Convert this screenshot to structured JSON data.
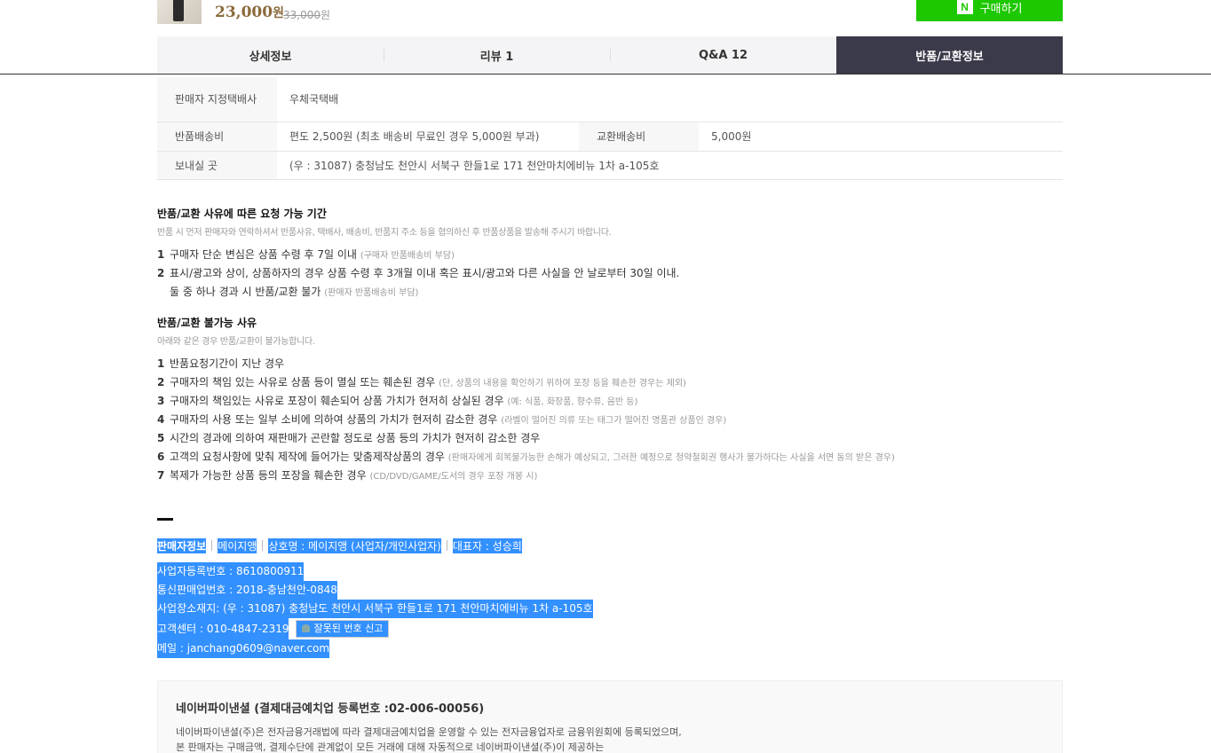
{
  "top": {
    "price": "23,000",
    "price_unit": "원",
    "original_price": "33,000",
    "original_unit": "원",
    "buy_icon": "N",
    "buy_label": "구매하기"
  },
  "tabs": [
    {
      "label": "상세정보"
    },
    {
      "label": "리뷰 1"
    },
    {
      "label": "Q&A 12"
    },
    {
      "label": "반품/교환정보",
      "active": true
    }
  ],
  "info_table": {
    "courier_label": "판매자 지정택배사",
    "courier_value": "우체국택배",
    "return_fee_label": "반품배송비",
    "return_fee_value": "편도 2,500원 (최초 배송비 무료인 경우 5,000원 부과)",
    "exchange_fee_label": "교환배송비",
    "exchange_fee_value": "5,000원",
    "address_label": "보내실 곳",
    "address_value": "(우 : 31087) 충청남도 천안시 서북구 한들1로 171 천안마치에비뉴 1차 a-105호"
  },
  "request_period": {
    "title": "반품/교환 사유에 따른 요청 가능 기간",
    "subtitle": "반품 시 먼저 판매자와 연락하셔서 반품사유, 택배사, 배송비, 반품지 주소 등을 협의하신 후 반품상품을 발송해 주시기 바랍니다.",
    "items": [
      {
        "num": "1",
        "text": "구매자 단순 변심은 상품 수령 후 7일 이내",
        "note": "(구매자 반품배송비 부담)"
      },
      {
        "num": "2",
        "text": "표시/광고와 상이, 상품하자의 경우 상품 수령 후 3개월 이내 혹은 표시/광고와 다른 사실을 안 날로부터 30일 이내.",
        "note": ""
      }
    ],
    "continuation_text": "둘 중 하나 경과 시 반품/교환 불가",
    "continuation_note": "(판매자 반품배송비 부담)"
  },
  "not_allowed": {
    "title": "반품/교환 불가능 사유",
    "subtitle": "아래와 같은 경우 반품/교환이 불가능합니다.",
    "items": [
      {
        "num": "1",
        "text": "반품요청기간이 지난 경우",
        "note": ""
      },
      {
        "num": "2",
        "text": "구매자의 책임 있는 사유로 상품 등이 멸실 또는 훼손된 경우",
        "note": "(단, 상품의 내용을 확인하기 위하여 포장 등을 훼손한 경우는 제외)"
      },
      {
        "num": "3",
        "text": "구매자의 책임있는 사유로 포장이 훼손되어 상품 가치가 현저히 상실된 경우",
        "note": "(예: 식품, 화장품, 향수류, 음반 등)"
      },
      {
        "num": "4",
        "text": "구매자의 사용 또는 일부 소비에 의하여 상품의 가치가 현저히 감소한 경우",
        "note": "(라벨이 떨어진 의류 또는 태그가 떨어진 명품관 상품인 경우)"
      },
      {
        "num": "5",
        "text": "시간의 경과에 의하여 재판매가 곤란할 정도로 상품 등의 가치가 현저히 감소한 경우",
        "note": ""
      },
      {
        "num": "6",
        "text": "고객의 요청사항에 맞춰 제작에 들어가는 맞춤제작상품의 경우",
        "note": "(판매자에게 회복불가능한 손해가 예상되고, 그러한 예정으로 청약철회권 행사가 불가하다는 사실을 서면 동의 받은 경우)"
      },
      {
        "num": "7",
        "text": "복제가 가능한 상품 등의 포장을 훼손한 경우",
        "note": "(CD/DVD/GAME/도서의 경우 포장 개봉 시)"
      }
    ]
  },
  "seller": {
    "label": "판매자정보",
    "shop": "메이지앵",
    "company": "상호명 : 메이지앵 (사업자/개인사업자)",
    "ceo": "대표자 : 성승희",
    "biz_no": "사업자등록번호 : 8610800911",
    "mail_order_no": "통신판매업번호 : 2018-충남천안-0848",
    "address": "사업장소재지: (우 : 31087) 충청남도 천안시 서북구 한들1로 171 천안마치에비뉴 1차 a-105호",
    "phone": "고객센터 : 010-4847-2319",
    "report_label": "잘못된 번호 신고",
    "email": "메일 : janchang0609@naver.com"
  },
  "naverpay": {
    "title": "네이버파이낸셜 (결제대금예치업 등록번호 :02-006-00056)",
    "line1": "네이버파이낸셜(주)은 전자금융거래법에 따라 결제대금예치업을 운영할 수 있는 전자금융업자로 금융위원회에 등록되었으며,",
    "line2": "본 판매자는 구매금액, 결제수단에 관계없이 모든 거래에 대해 자동적으로 네이버파이낸셜(주)이 제공하는"
  }
}
